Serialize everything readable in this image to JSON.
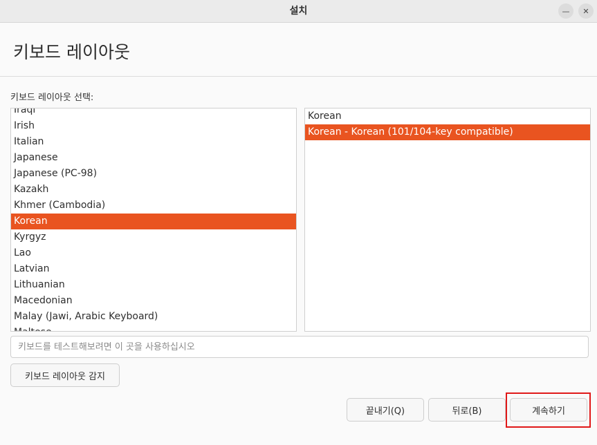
{
  "window": {
    "title": "설치"
  },
  "page": {
    "title": "키보드 레이아웃",
    "list_label": "키보드 레이아웃 선택:"
  },
  "layouts": [
    {
      "label": "Iraqi",
      "selected": false
    },
    {
      "label": "Irish",
      "selected": false
    },
    {
      "label": "Italian",
      "selected": false
    },
    {
      "label": "Japanese",
      "selected": false
    },
    {
      "label": "Japanese (PC-98)",
      "selected": false
    },
    {
      "label": "Kazakh",
      "selected": false
    },
    {
      "label": "Khmer (Cambodia)",
      "selected": false
    },
    {
      "label": "Korean",
      "selected": true
    },
    {
      "label": "Kyrgyz",
      "selected": false
    },
    {
      "label": "Lao",
      "selected": false
    },
    {
      "label": "Latvian",
      "selected": false
    },
    {
      "label": "Lithuanian",
      "selected": false
    },
    {
      "label": "Macedonian",
      "selected": false
    },
    {
      "label": "Malay (Jawi, Arabic Keyboard)",
      "selected": false
    },
    {
      "label": "Maltese",
      "selected": false
    }
  ],
  "variants": [
    {
      "label": "Korean",
      "selected": false
    },
    {
      "label": "Korean - Korean (101/104-key compatible)",
      "selected": true
    }
  ],
  "test_field": {
    "placeholder": "키보드를 테스트해보려면 이 곳을 사용하십시오",
    "value": ""
  },
  "buttons": {
    "detect": "키보드 레이아웃 감지",
    "quit": "끝내기(Q)",
    "back": "뒤로(B)",
    "continue": "계속하기"
  },
  "colors": {
    "accent": "#e95420",
    "highlight_box": "#e01818"
  }
}
